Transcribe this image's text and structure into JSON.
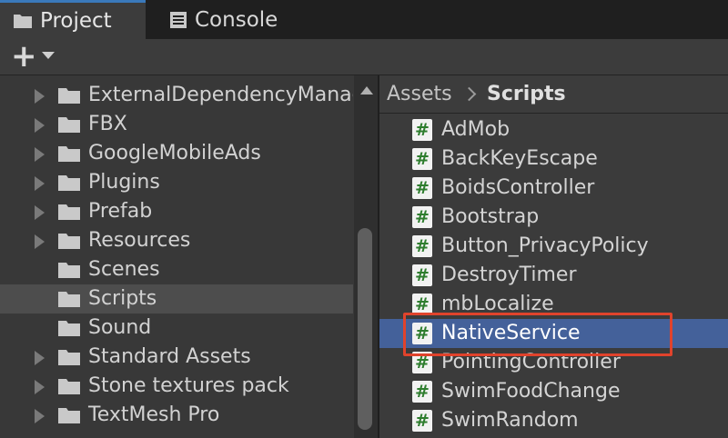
{
  "tabs": [
    {
      "label": "Project",
      "icon": "folder-icon",
      "active": true
    },
    {
      "label": "Console",
      "icon": "console-icon",
      "active": false
    }
  ],
  "toolbar": {
    "add_label": "+",
    "add_icon": "plus-icon",
    "dropdown_icon": "caret-down-icon"
  },
  "tree": {
    "items": [
      {
        "label": "ExternalDependencyManager",
        "expandable": true
      },
      {
        "label": "FBX",
        "expandable": true
      },
      {
        "label": "GoogleMobileAds",
        "expandable": true
      },
      {
        "label": "Plugins",
        "expandable": true
      },
      {
        "label": "Prefab",
        "expandable": true
      },
      {
        "label": "Resources",
        "expandable": true
      },
      {
        "label": "Scenes",
        "expandable": false
      },
      {
        "label": "Scripts",
        "expandable": false,
        "selected": true
      },
      {
        "label": "Sound",
        "expandable": false
      },
      {
        "label": "Standard Assets",
        "expandable": true
      },
      {
        "label": "Stone textures pack",
        "expandable": true
      },
      {
        "label": "TextMesh Pro",
        "expandable": true
      }
    ]
  },
  "breadcrumb": {
    "root": "Assets",
    "current": "Scripts"
  },
  "files": {
    "items": [
      {
        "label": "AdMob"
      },
      {
        "label": "BackKeyEscape"
      },
      {
        "label": "BoidsController"
      },
      {
        "label": "Bootstrap"
      },
      {
        "label": "Button_PrivacyPolicy"
      },
      {
        "label": "DestroyTimer"
      },
      {
        "label": "mbLocalize"
      },
      {
        "label": "NativeService",
        "selected": true
      },
      {
        "label": "PointingController"
      },
      {
        "label": "SwimFoodChange"
      },
      {
        "label": "SwimRandom"
      }
    ],
    "script_glyph": "#"
  },
  "colors": {
    "accent": "#3a79bb",
    "selection": "#44619a",
    "highlight_box": "#e0432c",
    "script_icon": "#2e7d2e"
  }
}
